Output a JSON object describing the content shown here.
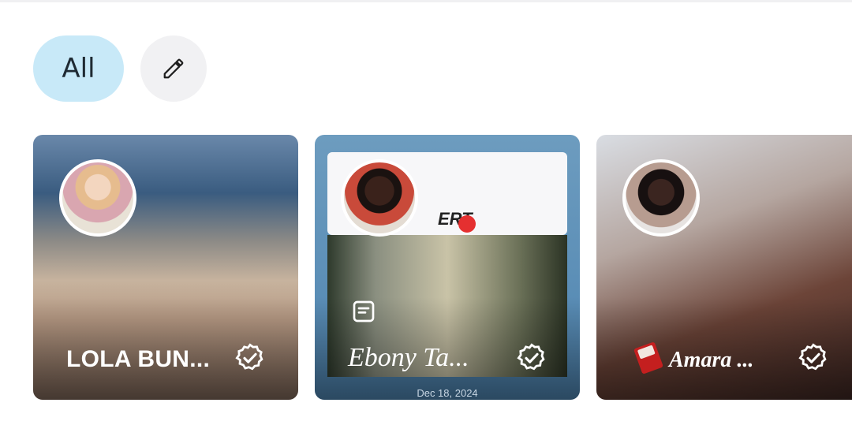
{
  "filters": {
    "all_label": "All",
    "edit_icon": "pencil-icon"
  },
  "cards": [
    {
      "name": "LOLA BUN...",
      "verified_icon": "verified-badge-icon"
    },
    {
      "name": "Ebony Ta...",
      "verified_icon": "verified-badge-icon",
      "preview_text": "ERT",
      "date": "Dec 18, 2024"
    },
    {
      "name": "Amara ...",
      "verified_icon": "verified-badge-icon"
    }
  ],
  "colors": {
    "chip_active": "#c8e9f8",
    "chip_inactive": "#f1f1f3",
    "text_dark": "#1f2a33"
  }
}
